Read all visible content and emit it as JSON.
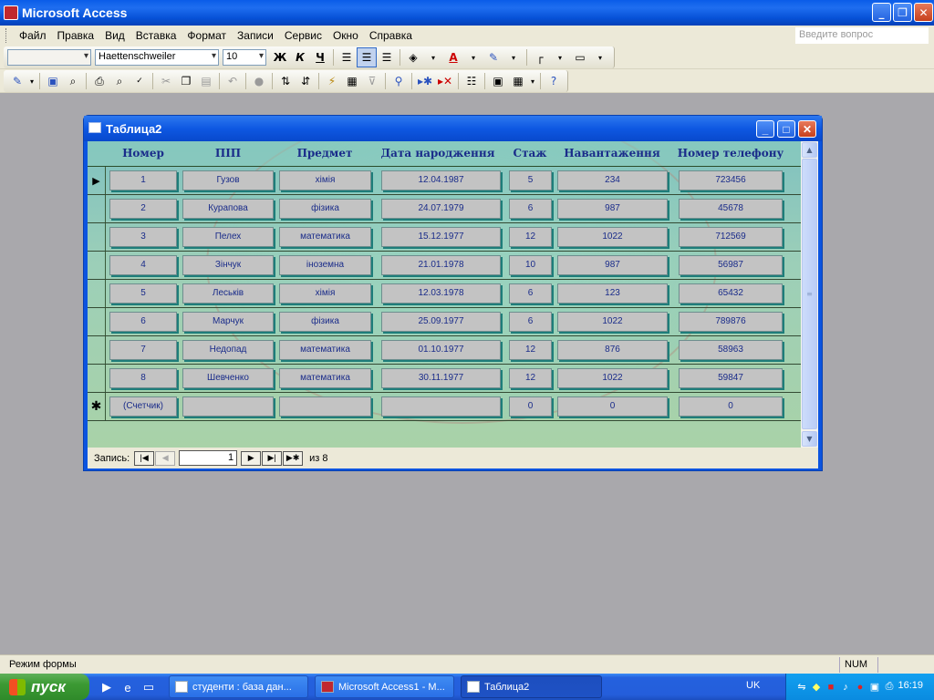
{
  "app": {
    "title": "Microsoft Access"
  },
  "menu": [
    "Файл",
    "Правка",
    "Вид",
    "Вставка",
    "Формат",
    "Записи",
    "Сервис",
    "Окно",
    "Справка"
  ],
  "ask_placeholder": "Введите вопрос",
  "format_toolbar": {
    "font": "Haettenschweiler",
    "size": "10",
    "bold": "Ж",
    "italic": "К",
    "underline": "Ч"
  },
  "form_window": {
    "title": "Таблица2"
  },
  "columns": [
    "Номер",
    "ПІП",
    "Предмет",
    "Дата народження",
    "Стаж",
    "Навантаження",
    "Номер телефону"
  ],
  "records": [
    [
      "1",
      "Гузов",
      "хімія",
      "12.04.1987",
      "5",
      "234",
      "723456"
    ],
    [
      "2",
      "Курапова",
      "фізика",
      "24.07.1979",
      "6",
      "987",
      "45678"
    ],
    [
      "3",
      "Пелех",
      "математика",
      "15.12.1977",
      "12",
      "1022",
      "712569"
    ],
    [
      "4",
      "Зінчук",
      "іноземна",
      "21.01.1978",
      "10",
      "987",
      "56987"
    ],
    [
      "5",
      "Леськів",
      "хімія",
      "12.03.1978",
      "6",
      "123",
      "65432"
    ],
    [
      "6",
      "Марчук",
      "фізика",
      "25.09.1977",
      "6",
      "1022",
      "789876"
    ],
    [
      "7",
      "Недопад",
      "математика",
      "01.10.1977",
      "12",
      "876",
      "58963"
    ],
    [
      "8",
      "Шевченко",
      "математика",
      "30.11.1977",
      "12",
      "1022",
      "59847"
    ]
  ],
  "new_record": [
    "(Счетчик)",
    "",
    "",
    "",
    "0",
    "0",
    "0"
  ],
  "selectors": {
    "current": "▶",
    "new": "✱"
  },
  "navigation": {
    "label": "Запись:",
    "current": "1",
    "of_text": "из  8"
  },
  "status": {
    "text": "Режим формы",
    "num": "NUM"
  },
  "taskbar": {
    "start": "пуск",
    "tasks": [
      "студенти : база дан...",
      "Microsoft Access1 - M...",
      "Таблица2"
    ],
    "lang": "UK",
    "clock": "16:19"
  },
  "colors": {
    "title_blue": "#0b54e0",
    "cell_gray": "#c3c3c3",
    "label_navy": "#1a2c8a",
    "form_teal": "#7fc1c0"
  }
}
